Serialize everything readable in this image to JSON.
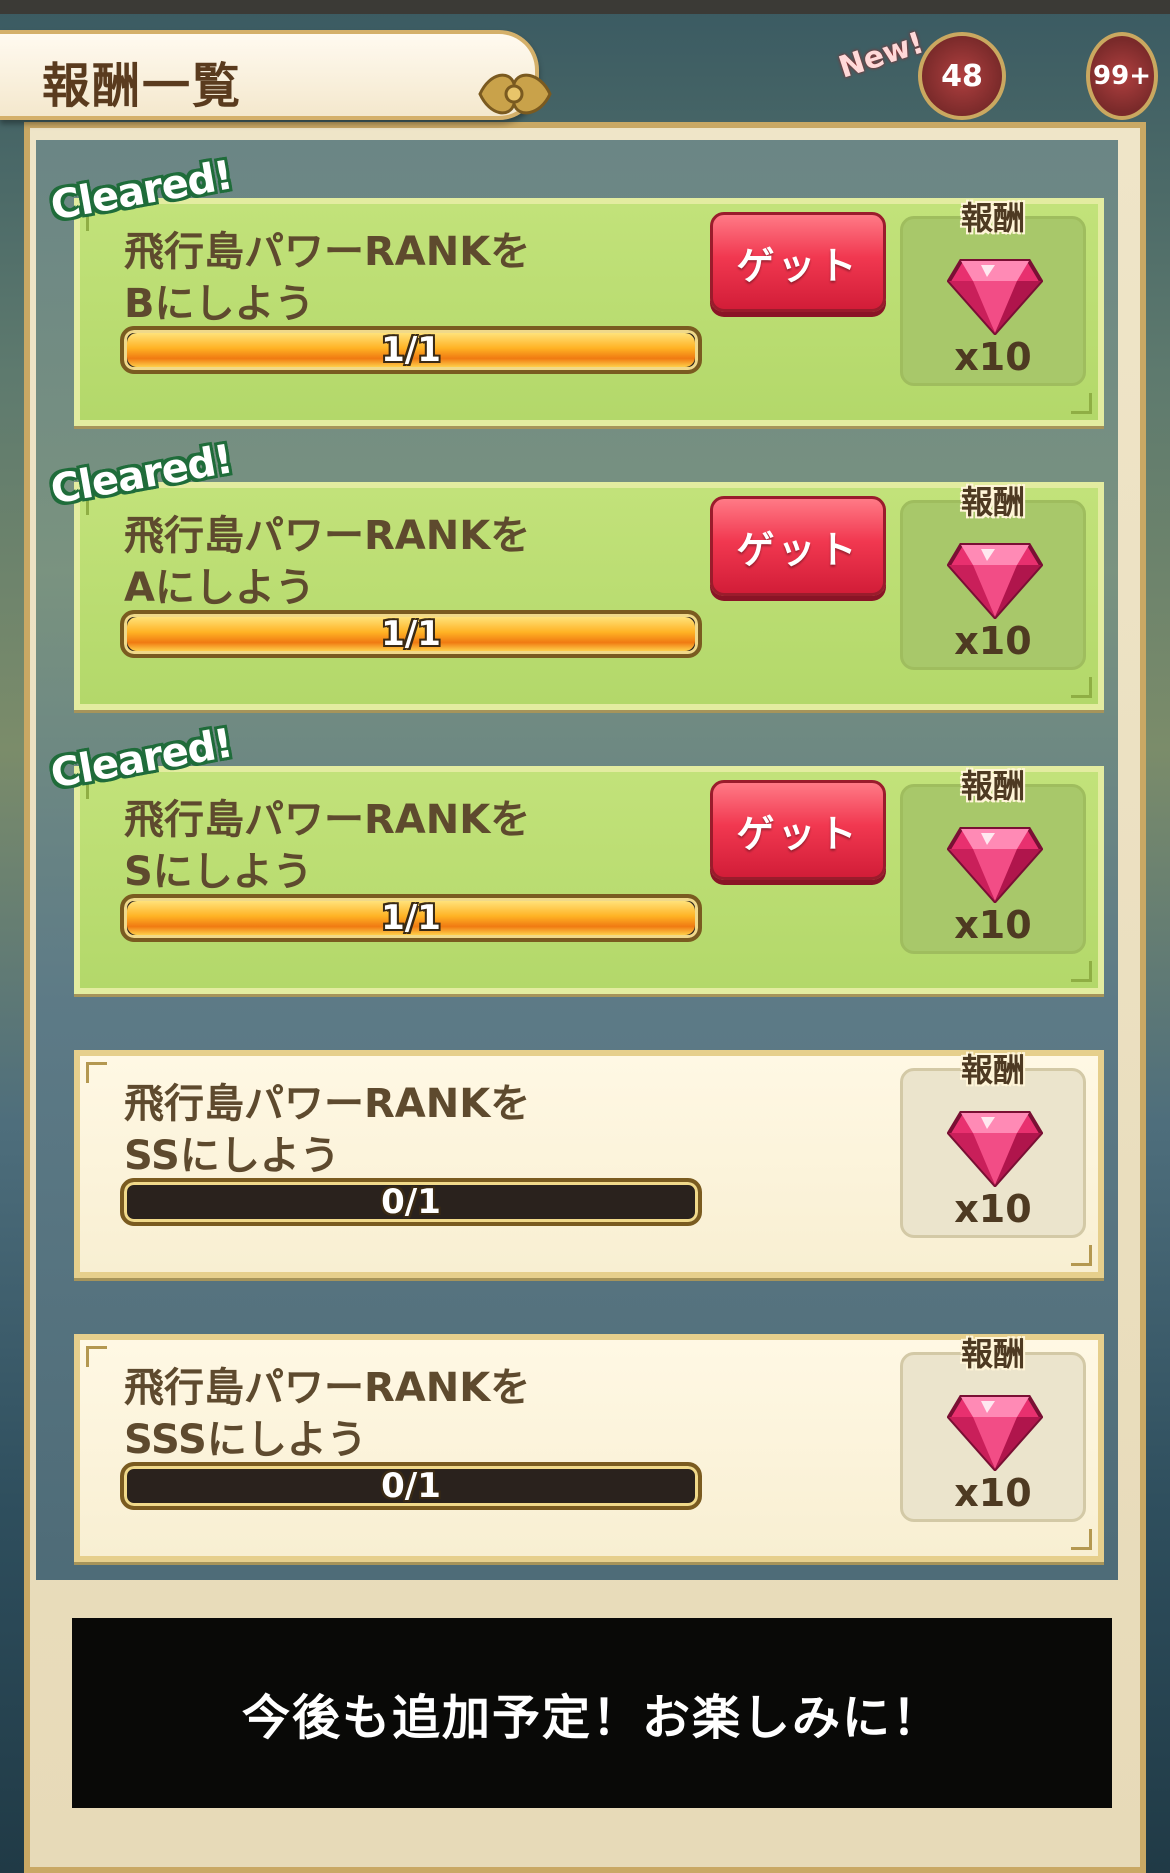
{
  "header": {
    "title": "報酬一覧",
    "new_badge_text": "New!",
    "badge_count_1": "48",
    "badge_count_2": "99+"
  },
  "colors": {
    "cleared_bg": "#b8dc70",
    "pending_bg": "#fbf3dc",
    "get_button": "#f13850",
    "gem": "#e8306f"
  },
  "missions": [
    {
      "status": "cleared",
      "cleared_label": "Cleared!",
      "title_line1": "飛行島パワーRANKを",
      "title_line2": "Bにしよう",
      "progress_text": "1/1",
      "progress": 1.0,
      "button_label": "ゲット",
      "reward_label": "報酬",
      "reward_icon": "gem-icon",
      "reward_qty": "x10"
    },
    {
      "status": "cleared",
      "cleared_label": "Cleared!",
      "title_line1": "飛行島パワーRANKを",
      "title_line2": "Aにしよう",
      "progress_text": "1/1",
      "progress": 1.0,
      "button_label": "ゲット",
      "reward_label": "報酬",
      "reward_icon": "gem-icon",
      "reward_qty": "x10"
    },
    {
      "status": "cleared",
      "cleared_label": "Cleared!",
      "title_line1": "飛行島パワーRANKを",
      "title_line2": "Sにしよう",
      "progress_text": "1/1",
      "progress": 1.0,
      "button_label": "ゲット",
      "reward_label": "報酬",
      "reward_icon": "gem-icon",
      "reward_qty": "x10"
    },
    {
      "status": "pending",
      "title_line1": "飛行島パワーRANKを",
      "title_line2": "SSにしよう",
      "progress_text": "0/1",
      "progress": 0,
      "reward_label": "報酬",
      "reward_icon": "gem-icon",
      "reward_qty": "x10"
    },
    {
      "status": "pending",
      "title_line1": "飛行島パワーRANKを",
      "title_line2": "SSSにしよう",
      "progress_text": "0/1",
      "progress": 0,
      "reward_label": "報酬",
      "reward_icon": "gem-icon",
      "reward_qty": "x10"
    }
  ],
  "toast": {
    "message": "今後も追加予定！お楽しみに！"
  }
}
